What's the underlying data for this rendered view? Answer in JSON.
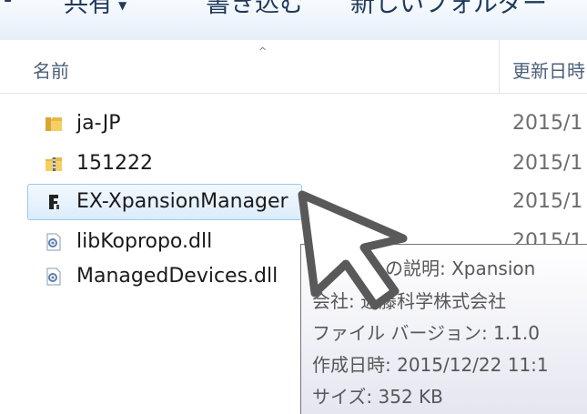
{
  "toolbar": {
    "share_label": "共有",
    "burn_label": "書き込む",
    "new_folder_label": "新しいフォルダー",
    "dropdown_arrow": "▼",
    "bullet": "▪"
  },
  "columns": {
    "name": "名前",
    "date_modified": "更新日時",
    "sort_indicator": "^"
  },
  "files": [
    {
      "name": "ja-JP",
      "date": "2015/1",
      "icon": "folder-icon"
    },
    {
      "name": "151222",
      "date": "2015/1",
      "icon": "zip-folder-icon"
    },
    {
      "name": "EX-XpansionManager",
      "date": "2015/1",
      "icon": "app-icon",
      "selected": true
    },
    {
      "name": "libKopropo.dll",
      "date": "2015/1",
      "icon": "dll-icon"
    },
    {
      "name": "ManagedDevices.dll",
      "date": "",
      "icon": "dll-icon"
    }
  ],
  "tooltip": {
    "description": "ファイルの説明: Xpansion",
    "company": "会社: 近藤科学株式会社",
    "version": "ファイル バージョン: 1.1.0",
    "created": "作成日時: 2015/12/22 11:1",
    "size": "サイズ: 352 KB"
  },
  "colors": {
    "selection_border": "#99c9ef",
    "selection_fill": "#dcecfb",
    "header_text": "#4c607a",
    "toolbar_text": "#1e395b"
  }
}
